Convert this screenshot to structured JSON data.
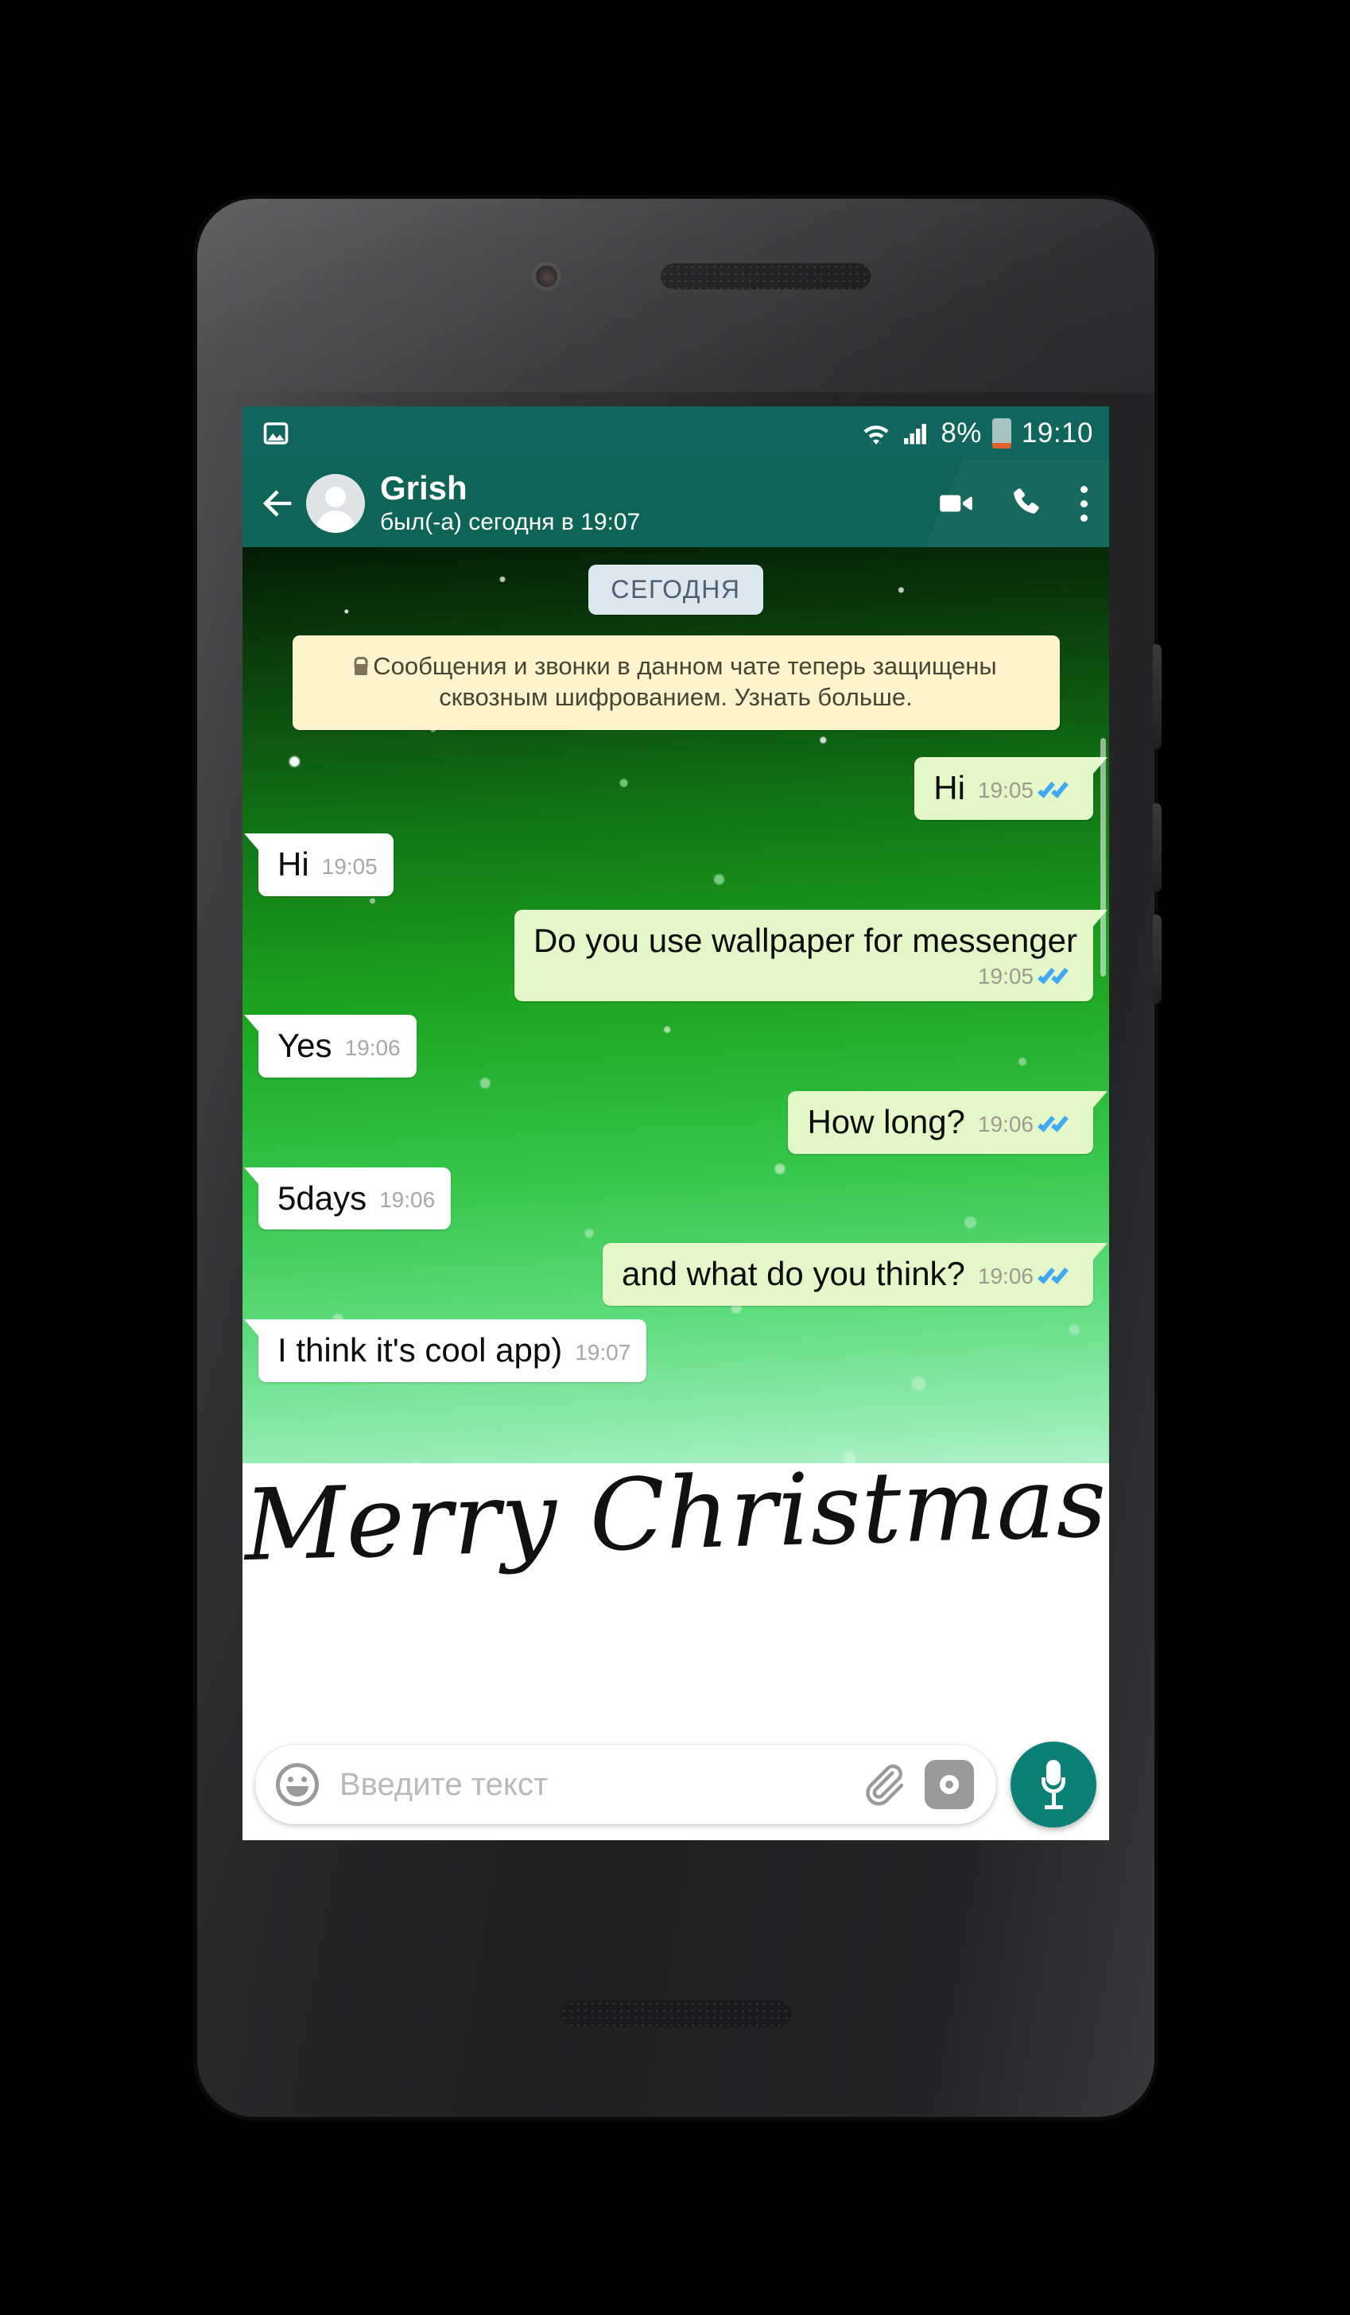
{
  "status_bar": {
    "notification_icon": "image-icon",
    "wifi_icon": "wifi-icon",
    "signal_icon": "cellular-signal-icon",
    "battery_percent": "8%",
    "battery_icon": "battery-icon",
    "time": "19:10"
  },
  "app_bar": {
    "back_icon": "back-arrow-icon",
    "avatar": "default-avatar-icon",
    "contact_name": "Grish",
    "contact_status": "был(-а) сегодня в 19:07",
    "video_call_icon": "video-call-icon",
    "voice_call_icon": "phone-call-icon",
    "overflow_icon": "overflow-menu-icon"
  },
  "chat": {
    "date_divider": "СЕГОДНЯ",
    "encryption_notice": "Сообщения и звонки в данном чате теперь защищены сквозным шифрованием. Узнать больше.",
    "lock_icon": "lock-icon",
    "messages": [
      {
        "text": "Hi",
        "time": "19:05",
        "side": "out",
        "status": "read"
      },
      {
        "text": "Hi",
        "time": "19:05",
        "side": "in",
        "status": ""
      },
      {
        "text": "Do you use wallpaper for messenger",
        "time": "19:05",
        "side": "out",
        "status": "read"
      },
      {
        "text": "Yes",
        "time": "19:06",
        "side": "in",
        "status": ""
      },
      {
        "text": "How long?",
        "time": "19:06",
        "side": "out",
        "status": "read"
      },
      {
        "text": "5days",
        "time": "19:06",
        "side": "in",
        "status": ""
      },
      {
        "text": "and what do you think?",
        "time": "19:06",
        "side": "out",
        "status": "read"
      },
      {
        "text": "I think it's cool app)",
        "time": "19:07",
        "side": "in",
        "status": ""
      }
    ]
  },
  "wallpaper": {
    "greeting_text": "Merry Christmas"
  },
  "input_bar": {
    "emoji_icon": "emoji-smiley-icon",
    "placeholder": "Введите текст",
    "attach_icon": "paperclip-icon",
    "camera_icon": "camera-icon",
    "mic_icon": "microphone-icon"
  },
  "colors": {
    "status_bar": "#10655c",
    "app_bar": "#0f6458",
    "outgoing_bubble": "#e3f7c8",
    "incoming_bubble": "#fdfdfd",
    "encryption_notice": "#fdf4cd",
    "date_chip": "#dde7ef",
    "tick_blue": "#3fa9f5",
    "mic_button": "#0c8074"
  }
}
